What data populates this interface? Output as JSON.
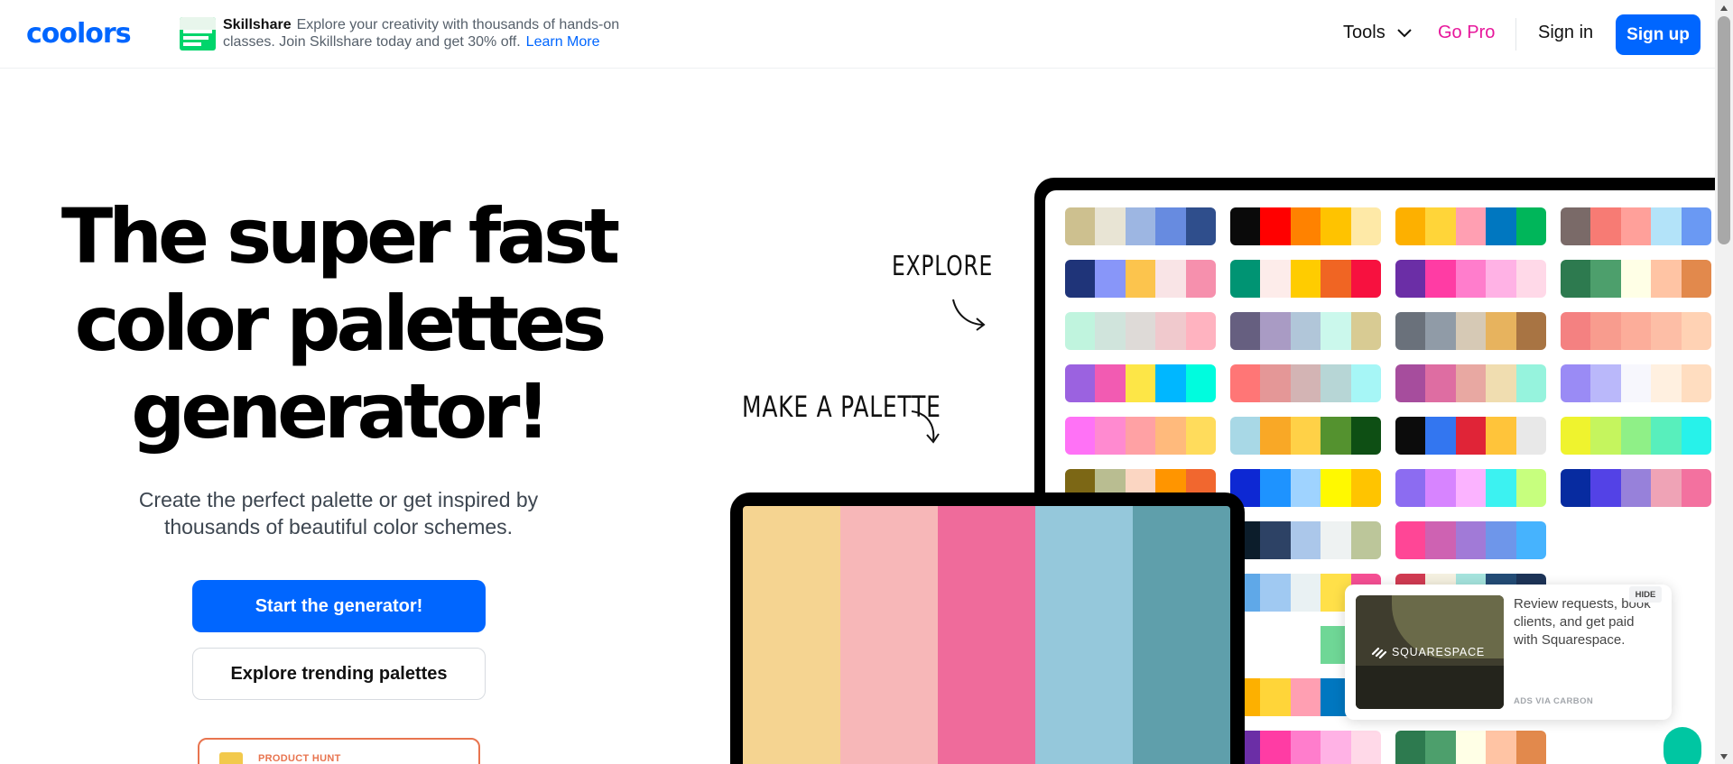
{
  "header": {
    "logo": "coolors",
    "ad": {
      "brand": "Skillshare",
      "text": "Explore your creativity with thousands of hands-on classes. Join Skillshare today and get 30% off.",
      "link": "Learn More"
    },
    "nav": {
      "tools": "Tools",
      "go_pro": "Go Pro",
      "sign_in": "Sign in",
      "sign_up": "Sign up"
    }
  },
  "hero": {
    "title_line1": "The super fast",
    "title_line2": "color palettes",
    "title_line3": "generator!",
    "subtitle": "Create the perfect palette or get inspired by thousands of beautiful color schemes.",
    "cta_primary": "Start the generator!",
    "cta_secondary": "Explore trending palettes",
    "badge_label": "PRODUCT HUNT"
  },
  "illustration": {
    "explore_label": "EXPLORE",
    "make_label": "MAKE A PALETTE",
    "laptop_palette": [
      "#f5d491",
      "#f7b7b8",
      "#ef6b9b",
      "#95c8db",
      "#5f9fab"
    ],
    "grid_palettes": [
      [
        "#cdc08f",
        "#e8e4d4",
        "#9db6e2",
        "#678be0",
        "#2f4e8c"
      ],
      [
        "#0a0a0a",
        "#ff0000",
        "#ff8200",
        "#ffc300",
        "#fee9a7"
      ],
      [
        "#fdb000",
        "#ffd539",
        "#ff9fb2",
        "#0077c0",
        "#00b65a"
      ],
      [
        "#7a6a68",
        "#f77b74",
        "#ffa09a",
        "#b3e3f9",
        "#6a99f3"
      ],
      [
        "#1f3479",
        "#8896f9",
        "#fcc44d",
        "#f9e4e6",
        "#f690ad"
      ],
      [
        "#009473",
        "#fdecea",
        "#ffcc00",
        "#f06523",
        "#f7113f"
      ],
      [
        "#6b2ea6",
        "#ff3ca4",
        "#ff7dcc",
        "#ffb2e5",
        "#ffd9e8"
      ],
      [
        "#2d7a4f",
        "#4d9f6c",
        "#ffffe6",
        "#ffc4a4",
        "#e2894c"
      ],
      [
        "#c0f4de",
        "#d0e4dc",
        "#dedad7",
        "#f0c9cd",
        "#ffb3c0"
      ],
      [
        "#665f80",
        "#a99bc4",
        "#b1c6d9",
        "#cbf8ec",
        "#d8cb93"
      ],
      [
        "#6a717b",
        "#909ba7",
        "#d6c9b5",
        "#e7b35e",
        "#a87443"
      ],
      [
        "#f48181",
        "#f89c8e",
        "#fcad9a",
        "#fdbea6",
        "#ffd2b4"
      ],
      [
        "#9b62e0",
        "#f25bb2",
        "#fde647",
        "#00b7ff",
        "#00fcde"
      ],
      [
        "#ff7676",
        "#e49797",
        "#d3b4b4",
        "#b7d6d6",
        "#a6f6f6"
      ],
      [
        "#a64d9d",
        "#de6da2",
        "#e8a8a2",
        "#f0ddb0",
        "#96f3dd"
      ],
      [
        "#9a8bf5",
        "#bab8fa",
        "#f7f7fd",
        "#fff0e0",
        "#ffddc0"
      ],
      [
        "#ff72f6",
        "#ff8ad0",
        "#ffa1a4",
        "#ffba7c",
        "#ffdc5c"
      ],
      [
        "#a8d8e6",
        "#f9a826",
        "#ffd147",
        "#54922f",
        "#0e4f14"
      ],
      [
        "#0c0c0c",
        "#3376f0",
        "#e02437",
        "#ffc43a",
        "#e8e8e8"
      ],
      [
        "#eff32e",
        "#c5f55e",
        "#8ff087",
        "#58efbc",
        "#27f2ea"
      ],
      [
        "#7c6715",
        "#b9bd91",
        "#fbd6c2",
        "#ff9500",
        "#f1672f"
      ],
      [
        "#0d28d3",
        "#1e93ff",
        "#9fd3ff",
        "#fff900",
        "#ffc400"
      ],
      [
        "#8c6cf1",
        "#d784ff",
        "#fbb3ff",
        "#3cf2f1",
        "#c7ff7e"
      ],
      [
        "#072ba0",
        "#5342e6",
        "#9781da",
        "#efa3b6",
        "#f3719f"
      ],
      [
        "#7a5a48",
        "#c29f86",
        "#fed4ac",
        "#f8f5fb",
        "#b8a8e5"
      ],
      [
        "#0c1d2b",
        "#2d4265",
        "#abc7ea",
        "#eef2f2",
        "#bcc69a"
      ],
      [
        "#ff4696",
        "#ce62b2",
        "#a17ad7",
        "#6e96ea",
        "#46b3fe"
      ],
      [
        "#2c7f8f",
        "#429fb7",
        "#81c5cc",
        "#e9e8e0",
        "#faa627"
      ],
      [
        "#5fa8e8",
        "#a0c9f2",
        "#e9f1f3",
        "#ffe049",
        "#f64f94"
      ],
      [
        "#d13b52",
        "#f4f0e0",
        "#a5e3dd",
        "#234c76",
        "#1d3458"
      ],
      [
        "#0d2a1b",
        "#024e2c",
        "#dd7aa2",
        "#f7b2c2",
        "#ffe2e4"
      ],
      [
        "#ffffff",
        "#ffffff",
        "#ffffff",
        "#6fd796",
        "#c3f8c9"
      ],
      [
        "#0a0a0a",
        "#ff0000",
        "#ff8200",
        "#ffc300",
        "#fee9a7"
      ],
      [
        "#fdb000",
        "#ffd539",
        "#ff9fb2",
        "#0077c0",
        "#00b65a"
      ],
      [
        "#7a6a68",
        "#f77b74",
        "#ffa09a",
        "#b3e3f9",
        "#6a99f3"
      ],
      [
        "#009473",
        "#fdecea",
        "#ffcc00",
        "#f06523",
        "#f7113f"
      ],
      [
        "#6b2ea6",
        "#ff3ca4",
        "#ff7dcc",
        "#ffb2e5",
        "#ffd9e8"
      ],
      [
        "#2d7a4f",
        "#4d9f6c",
        "#ffffe6",
        "#ffc4a4",
        "#e2894c"
      ]
    ]
  },
  "carbon_ad": {
    "brand": "SQUARESPACE",
    "text": "Review requests, book clients, and get paid with Squarespace.",
    "via": "ADS VIA CARBON",
    "hide": "HIDE"
  },
  "colors": {
    "accent": "#0066ff",
    "pro": "#e7179b",
    "badge": "#e8744f"
  },
  "icons": {
    "tools_chevron": "chevron-down-icon",
    "explore_arrow": "curved-arrow-icon",
    "make_arrow": "curved-arrow-icon",
    "product_hunt": "trophy-icon",
    "squarespace_logo": "squarespace-logo-icon"
  }
}
